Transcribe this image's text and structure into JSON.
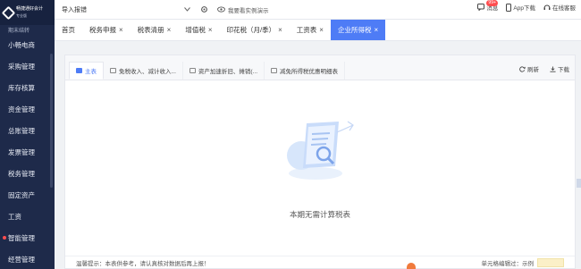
{
  "brand": {
    "name": "畅捷通好会计",
    "edition": "专业版"
  },
  "sidebar": {
    "partial_label": "期末结转",
    "items": [
      {
        "label": "小畅电商",
        "alert": false
      },
      {
        "label": "采购管理",
        "alert": false
      },
      {
        "label": "库存核算",
        "alert": false
      },
      {
        "label": "资金管理",
        "alert": false
      },
      {
        "label": "总账管理",
        "alert": false
      },
      {
        "label": "发票管理",
        "alert": false
      },
      {
        "label": "税务管理",
        "alert": false
      },
      {
        "label": "固定资产",
        "alert": false
      },
      {
        "label": "工资",
        "alert": false
      },
      {
        "label": "智能管理",
        "alert": true
      },
      {
        "label": "经营管理",
        "alert": false
      }
    ]
  },
  "topbar": {
    "company": "导入报错",
    "demo": "我要看实例演示",
    "messages": "消息",
    "badge": "99+",
    "app": "App下载",
    "support": "在线客服"
  },
  "tabs": [
    {
      "label": "首页",
      "closable": false,
      "active": false
    },
    {
      "label": "税务申报",
      "closable": true,
      "active": false
    },
    {
      "label": "税表清册",
      "closable": true,
      "active": false
    },
    {
      "label": "增值税",
      "closable": true,
      "active": false
    },
    {
      "label": "印花税（月/季）",
      "closable": true,
      "active": false
    },
    {
      "label": "工资表",
      "closable": true,
      "active": false
    },
    {
      "label": "企业所得税",
      "closable": true,
      "active": true
    }
  ],
  "subtabs": [
    {
      "label": "主表",
      "active": true
    },
    {
      "label": "免税收入、减计收入...",
      "active": false
    },
    {
      "label": "资产加速折旧、摊销(...",
      "active": false
    },
    {
      "label": "减免所得税优惠明细表",
      "active": false
    }
  ],
  "actions": {
    "refresh": "刷新",
    "download": "下载"
  },
  "empty": {
    "message": "本期无需计算税表"
  },
  "footer": {
    "tip": "温馨提示：本表供参考，请认真核对数据后再上报！",
    "legend_label": "单元格编辑过：示例"
  },
  "colors": {
    "accent": "#4e7cf6",
    "sidebar": "#1e2a4a",
    "alert": "#ff4d4f"
  }
}
